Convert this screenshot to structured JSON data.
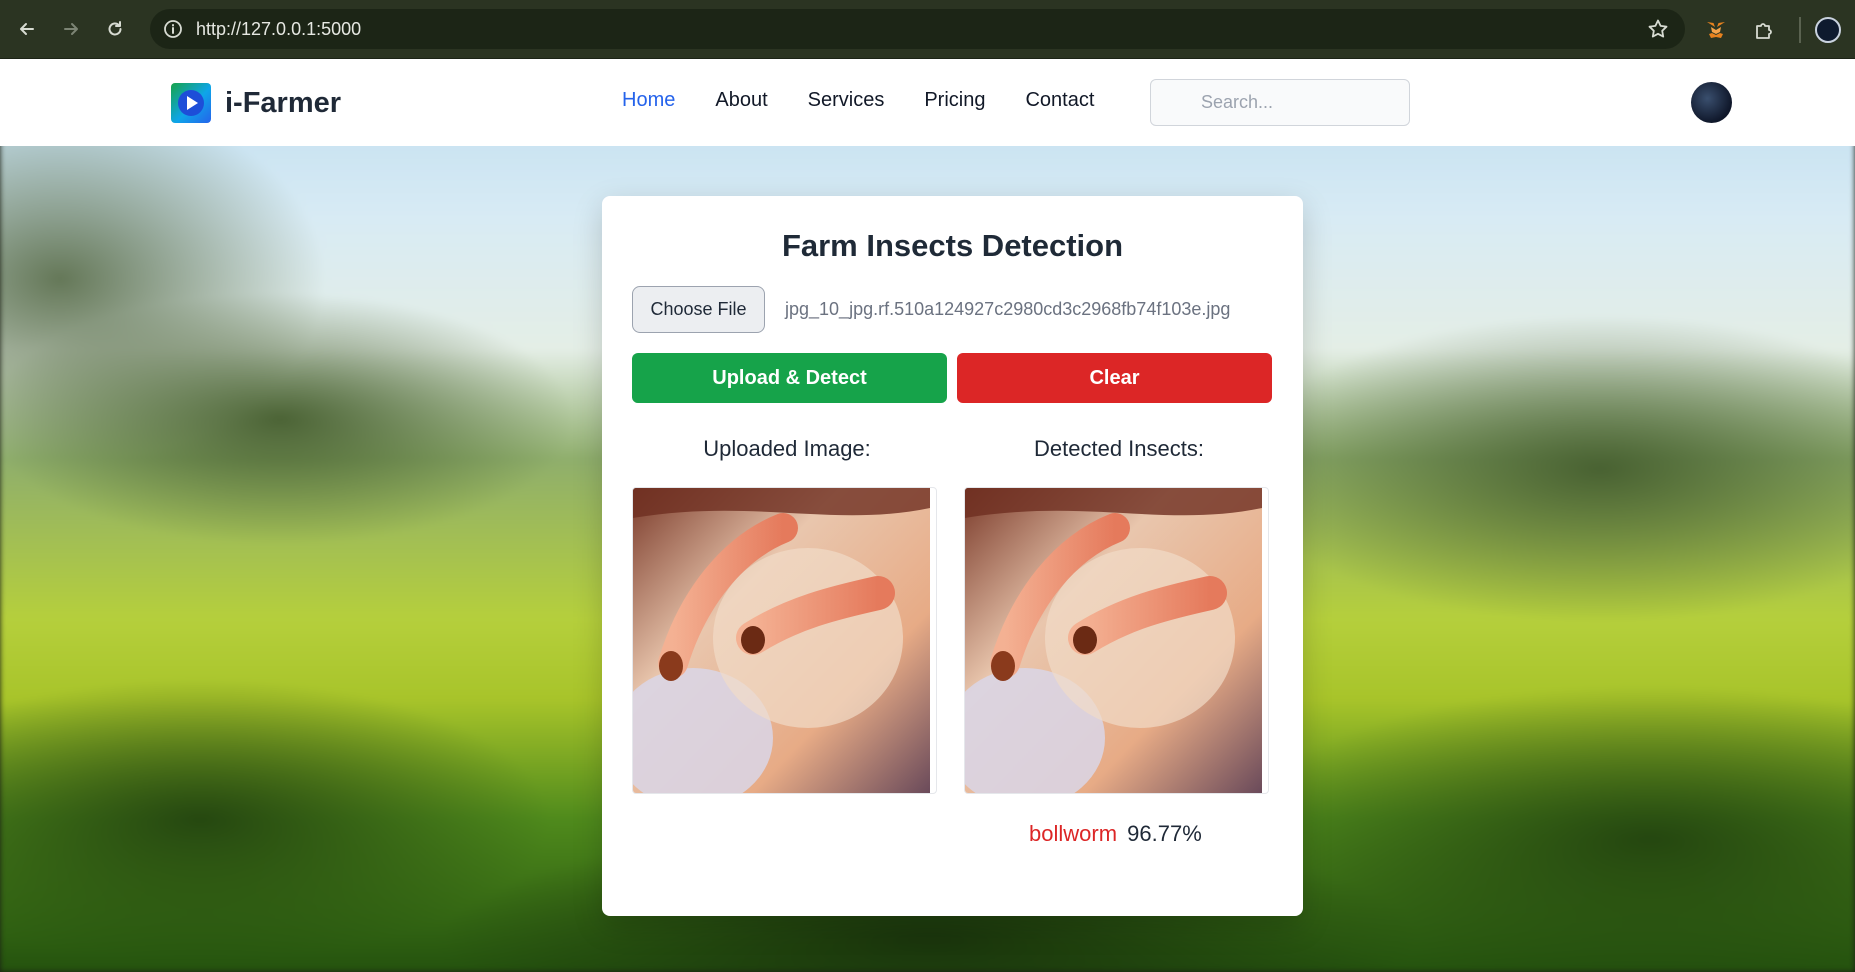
{
  "browser": {
    "url": "http://127.0.0.1:5000"
  },
  "site": {
    "brand": "i-Farmer",
    "nav": [
      "Home",
      "About",
      "Services",
      "Pricing",
      "Contact"
    ],
    "search_placeholder": "Search..."
  },
  "card": {
    "title": "Farm Insects Detection",
    "choose_file_label": "Choose File",
    "file_name": "jpg_10_jpg.rf.510a124927c2980cd3c2968fb74f103e.jpg",
    "upload_label": "Upload & Detect",
    "clear_label": "Clear",
    "uploaded_heading": "Uploaded Image:",
    "detected_heading": "Detected Insects:",
    "result": {
      "label": "bollworm",
      "confidence": "96.77%"
    }
  },
  "colors": {
    "accent": "#2563eb",
    "upload": "#16a34a",
    "clear": "#dc2626"
  }
}
